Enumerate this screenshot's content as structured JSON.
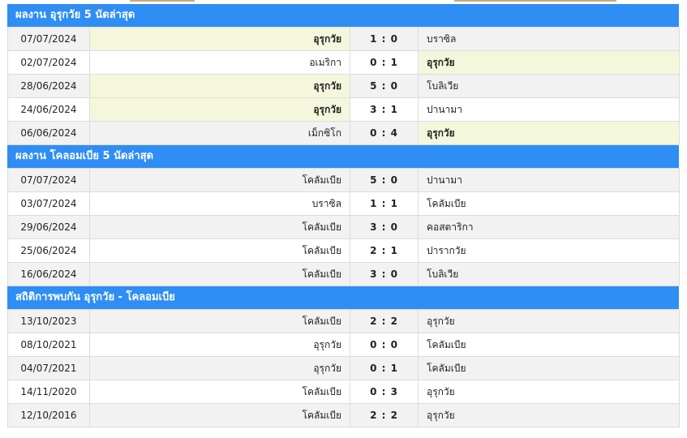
{
  "sections": [
    {
      "title": "ผลงาน อุรุกวัย 5 นัดล่าสุด",
      "rows": [
        {
          "date": "07/07/2024",
          "home": "อุรุกวัย",
          "score": "1 : 0",
          "away": "บราซิล",
          "highlight": "home"
        },
        {
          "date": "02/07/2024",
          "home": "อเมริกา",
          "score": "0 : 1",
          "away": "อุรุกวัย",
          "highlight": "away"
        },
        {
          "date": "28/06/2024",
          "home": "อุรุกวัย",
          "score": "5 : 0",
          "away": "โบลิเวีย",
          "highlight": "home"
        },
        {
          "date": "24/06/2024",
          "home": "อุรุกวัย",
          "score": "3 : 1",
          "away": "ปานามา",
          "highlight": "home"
        },
        {
          "date": "06/06/2024",
          "home": "เม็กซิโก",
          "score": "0 : 4",
          "away": "อุรุกวัย",
          "highlight": "away"
        }
      ]
    },
    {
      "title": "ผลงาน โคลอมเบีย 5 นัดล่าสุด",
      "rows": [
        {
          "date": "07/07/2024",
          "home": "โคลัมเบีย",
          "score": "5 : 0",
          "away": "ปานามา",
          "highlight": "none"
        },
        {
          "date": "03/07/2024",
          "home": "บราซิล",
          "score": "1 : 1",
          "away": "โคลัมเบีย",
          "highlight": "none"
        },
        {
          "date": "29/06/2024",
          "home": "โคลัมเบีย",
          "score": "3 : 0",
          "away": "คอสตาริกา",
          "highlight": "none"
        },
        {
          "date": "25/06/2024",
          "home": "โคลัมเบีย",
          "score": "2 : 1",
          "away": "ปารากวัย",
          "highlight": "none"
        },
        {
          "date": "16/06/2024",
          "home": "โคลัมเบีย",
          "score": "3 : 0",
          "away": "โบลิเวีย",
          "highlight": "none"
        }
      ]
    },
    {
      "title": "สถิติการพบกัน อุรุกวัย - โคลอมเบีย",
      "rows": [
        {
          "date": "13/10/2023",
          "home": "โคลัมเบีย",
          "score": "2 : 2",
          "away": "อุรุกวัย",
          "highlight": "none"
        },
        {
          "date": "08/10/2021",
          "home": "อุรุกวัย",
          "score": "0 : 0",
          "away": "โคลัมเบีย",
          "highlight": "none"
        },
        {
          "date": "04/07/2021",
          "home": "อุรุกวัย",
          "score": "0 : 1",
          "away": "โคลัมเบีย",
          "highlight": "none"
        },
        {
          "date": "14/11/2020",
          "home": "โคลัมเบีย",
          "score": "0 : 3",
          "away": "อุรุกวัย",
          "highlight": "none"
        },
        {
          "date": "12/10/2016",
          "home": "โคลัมเบีย",
          "score": "2 : 2",
          "away": "อุรุกวัย",
          "highlight": "none"
        }
      ]
    }
  ],
  "colors": {
    "header_bg": "#2f8ef4",
    "header_text": "#ffffff",
    "row_alt": "#f2f2f2",
    "row_plain": "#ffffff",
    "highlight": "#f5f7dc",
    "border": "#dcdcdc"
  }
}
